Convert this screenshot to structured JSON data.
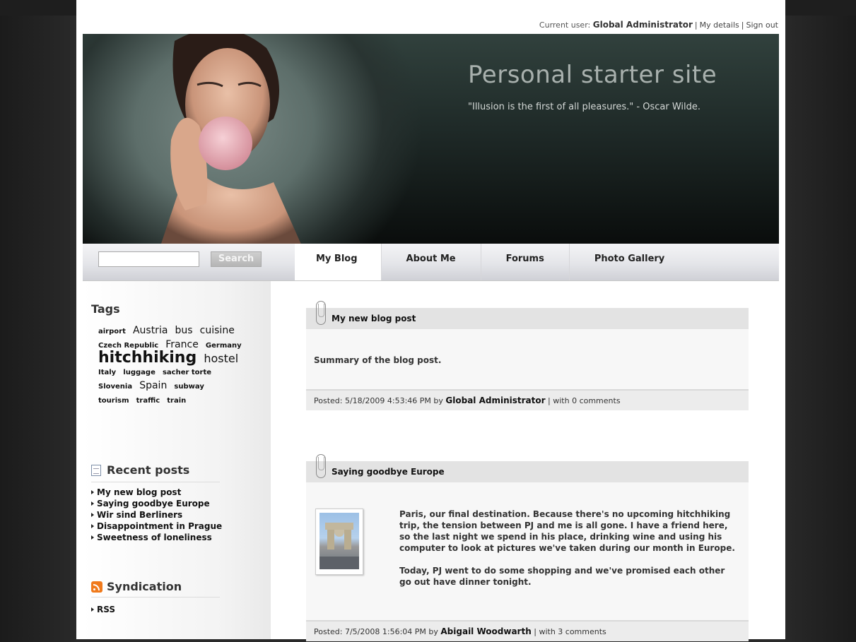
{
  "topbar": {
    "current_user_label": "Current user:",
    "current_user_name": "Global Administrator",
    "my_details": "My details",
    "sign_out": "Sign out"
  },
  "banner": {
    "title": "Personal starter site",
    "quote": "\"Illusion is the first of all pleasures.\" - Oscar Wilde."
  },
  "search": {
    "value": "",
    "button": "Search"
  },
  "nav": {
    "tabs": [
      "My Blog",
      "About Me",
      "Forums",
      "Photo Gallery"
    ],
    "active": "My Blog"
  },
  "sidebar": {
    "tags_title": "Tags",
    "tags": [
      {
        "label": "airport",
        "size": "s"
      },
      {
        "label": "Austria",
        "size": "m"
      },
      {
        "label": "bus",
        "size": "m"
      },
      {
        "label": "cuisine",
        "size": "m"
      },
      {
        "label": "Czech Republic",
        "size": "s"
      },
      {
        "label": "France",
        "size": "m"
      },
      {
        "label": "Germany",
        "size": "s"
      },
      {
        "label": "hitchhiking",
        "size": "xl"
      },
      {
        "label": "hostel",
        "size": "l"
      },
      {
        "label": "Italy",
        "size": "s"
      },
      {
        "label": "luggage",
        "size": "s"
      },
      {
        "label": "sacher torte",
        "size": "s"
      },
      {
        "label": "Slovenia",
        "size": "s"
      },
      {
        "label": "Spain",
        "size": "m"
      },
      {
        "label": "subway",
        "size": "s"
      },
      {
        "label": "tourism",
        "size": "s"
      },
      {
        "label": "traffic",
        "size": "s"
      },
      {
        "label": "train",
        "size": "s"
      }
    ],
    "recent_title": "Recent posts",
    "recent_posts": [
      "My new blog post",
      "Saying goodbye Europe",
      "Wir sind Berliners",
      "Disappointment in Prague",
      "Sweetness of loneliness"
    ],
    "syndication_title": "Syndication",
    "syndication_items": [
      "RSS"
    ]
  },
  "posts": [
    {
      "title": "My new blog post",
      "summary": "Summary of the blog post.",
      "posted_label": "Posted: 5/18/2009 4:53:46 PM by",
      "author": "Global Administrator",
      "comments": "| with 0 comments"
    },
    {
      "title": "Saying goodbye Europe",
      "paragraph1": "Paris, our final destination. Because there's no upcoming hitchhiking trip, the tension between PJ and me is all gone. I have a friend here, so the last night we spend in his place, drinking wine and using his computer to look at pictures we've taken during our month in Europe.",
      "paragraph2": "Today, PJ went to do some shopping and we've promised each other go out have dinner tonight.",
      "posted_label": "Posted: 7/5/2008 1:56:04 PM by",
      "author": "Abigail Woodwarth",
      "comments": "| with 3 comments"
    }
  ]
}
